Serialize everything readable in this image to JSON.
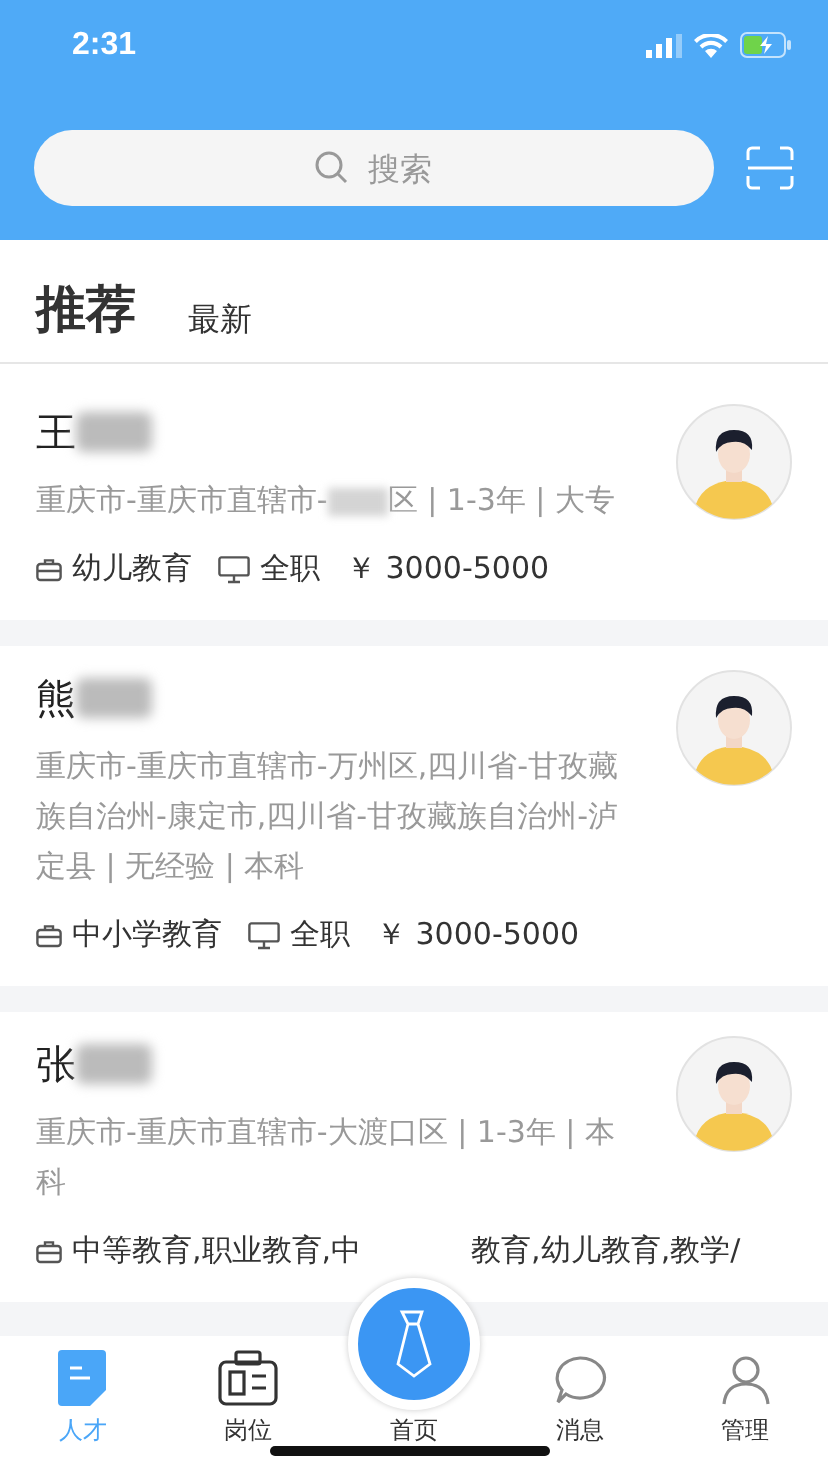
{
  "status_bar": {
    "time": "2:31"
  },
  "search": {
    "placeholder": "搜索"
  },
  "tabs": [
    {
      "label": "推荐",
      "selected": true
    },
    {
      "label": "最新",
      "selected": false
    }
  ],
  "cards": [
    {
      "surname": "王",
      "name_redacted": true,
      "address": [
        {
          "kind": "text",
          "text": "重庆市-重庆市直辖市-"
        },
        {
          "kind": "redacted"
        },
        {
          "kind": "text",
          "text": "区 | 1-3年 | 大专"
        }
      ],
      "category": "幼儿教育",
      "job_type": "全职",
      "salary": "￥ 3000-5000"
    },
    {
      "surname": "熊",
      "name_redacted": true,
      "address": [
        {
          "kind": "text",
          "text": "重庆市-重庆市直辖市-万州区,四川省-甘孜藏族自治州-康定市,四川省-甘孜藏族自治州-泸定县 | 无经验 | 本科"
        }
      ],
      "category": "中小学教育",
      "job_type": "全职",
      "salary": "￥ 3000-5000"
    },
    {
      "surname": "张",
      "name_redacted": true,
      "address": [
        {
          "kind": "text",
          "text": "重庆市-重庆市直辖市-大渡口区 | 1-3年 | 本科"
        }
      ],
      "category": "中等教育,职业教育,中",
      "category_tail": "教育,幼儿教育,教学/"
    }
  ],
  "nav": [
    {
      "label": "人才",
      "kind": "doc",
      "selected": true
    },
    {
      "label": "岗位",
      "kind": "badge",
      "selected": false
    },
    {
      "label": "首页",
      "kind": "center",
      "selected": false
    },
    {
      "label": "消息",
      "kind": "chat",
      "selected": false
    },
    {
      "label": "管理",
      "kind": "person",
      "selected": false
    }
  ]
}
